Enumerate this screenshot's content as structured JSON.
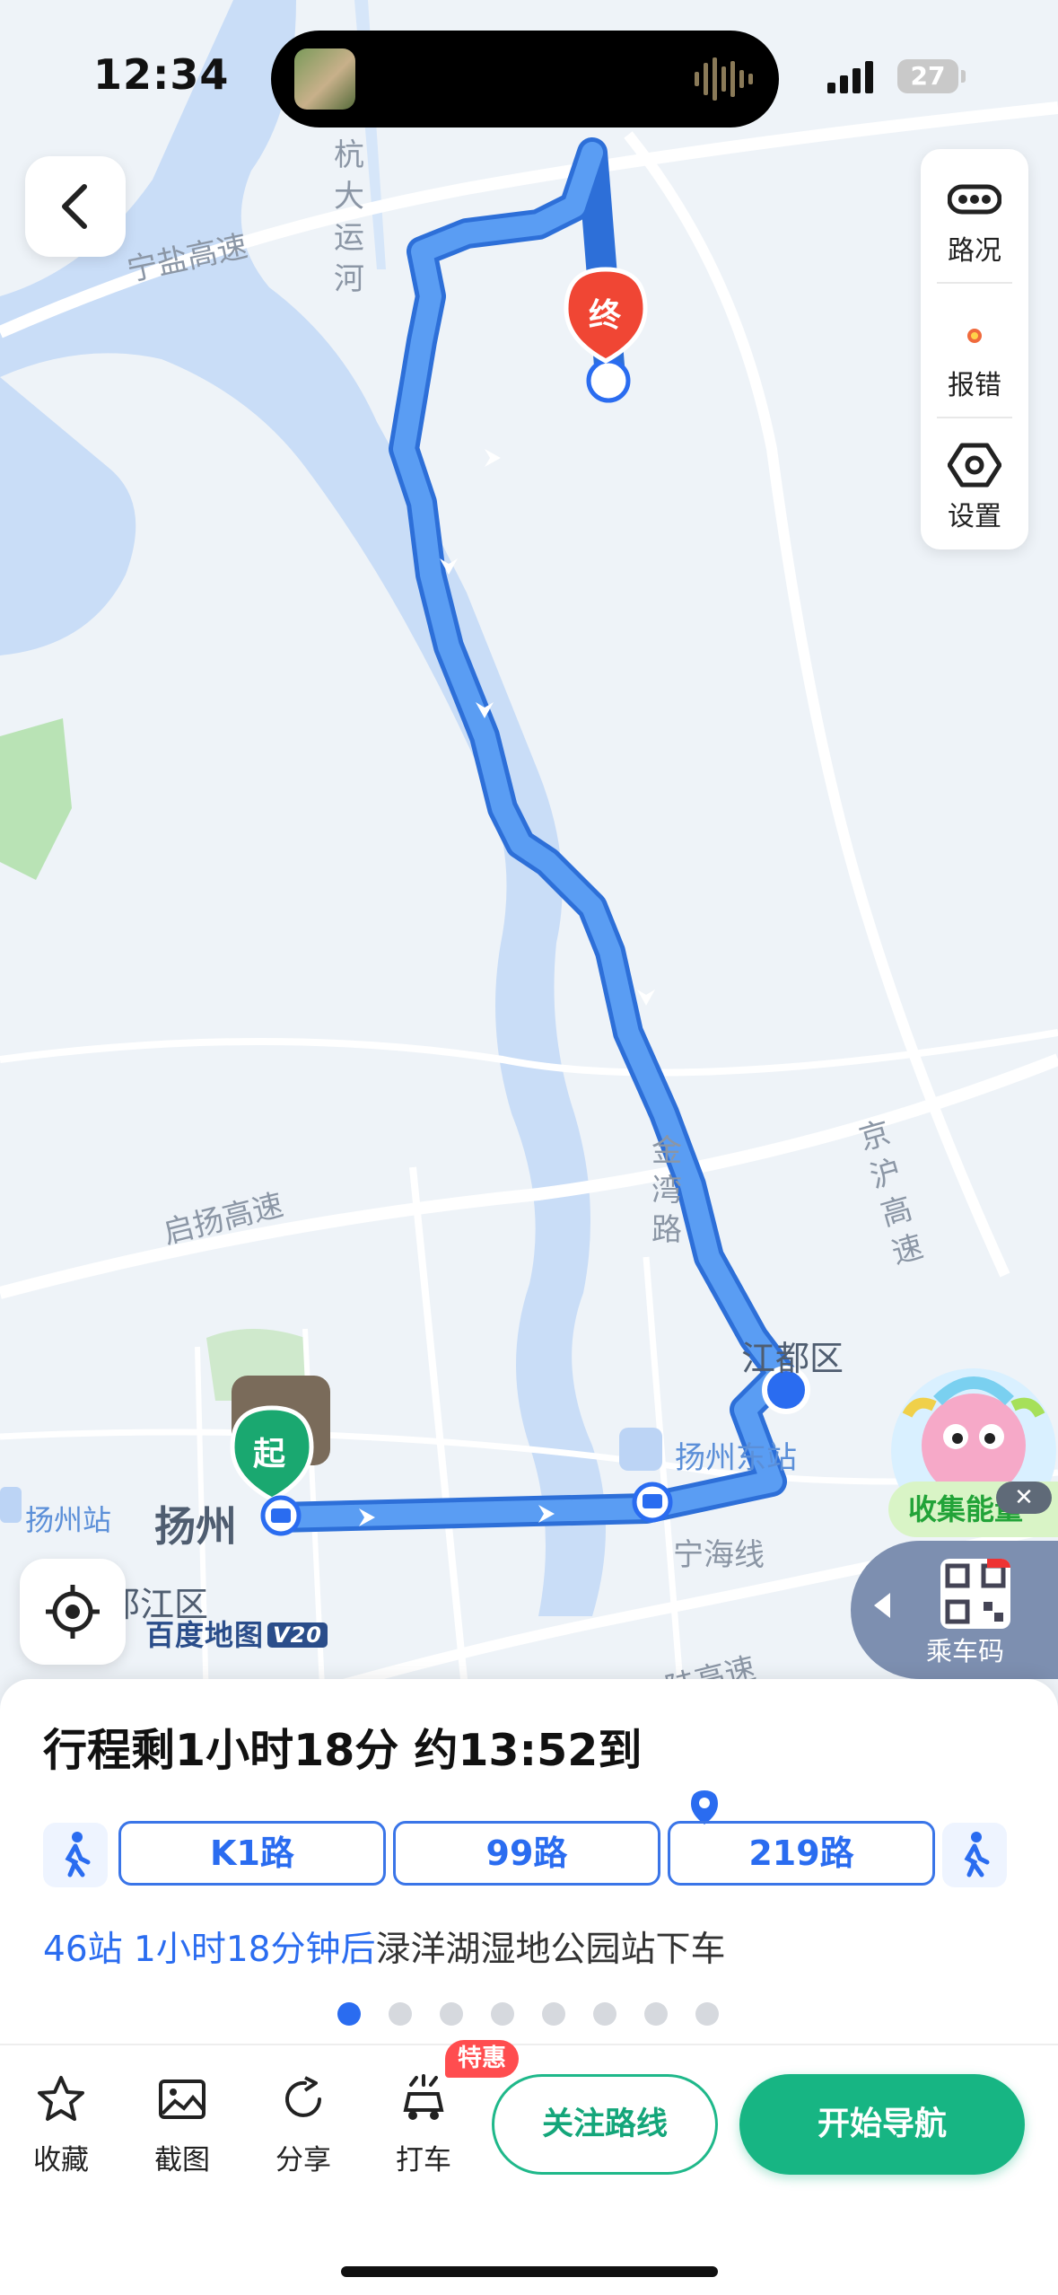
{
  "status_bar": {
    "time": "12:34",
    "battery": "27"
  },
  "toolbar": {
    "traffic_label": "路况",
    "report_label": "报错",
    "settings_label": "设置"
  },
  "map": {
    "labels": {
      "ningyan_highway": "宁盐高速",
      "grand_canal": "杭大运河",
      "qiyang_highway": "启扬高速",
      "jinwan_road": "金湾路",
      "jinghu_highway": "京沪高速",
      "jiangdu_district": "江都区",
      "yangzhou_east_station": "扬州东站",
      "yangzhou_station": "扬州站",
      "yangzhou": "扬州",
      "ninghai_line": "宁海线",
      "hanjiang_district": "邗江区",
      "highway_bottom": "陆高速"
    },
    "start_marker": "起",
    "end_marker": "终",
    "baidu_logo": "百度地图",
    "baidu_version": "V20",
    "collect_energy": "收集能量",
    "ride_code": "乘车码"
  },
  "trip": {
    "summary": "行程剩1小时18分 约13:52到",
    "routes": [
      "K1路",
      "99路",
      "219路"
    ],
    "detail_highlight": "46站 1小时18分钟后",
    "detail_rest": "渌洋湖湿地公园站下车",
    "page_count": 8,
    "active_page": 1
  },
  "actions": {
    "favorite": "收藏",
    "screenshot": "截图",
    "share": "分享",
    "taxi": "打车",
    "promo_badge": "特惠",
    "follow_route": "关注路线",
    "start_navigation": "开始导航"
  },
  "colors": {
    "route_blue": "#4a8ef0",
    "accent_blue": "#2a6cf0",
    "start_green": "#1aa870",
    "end_red": "#f04634",
    "nav_green": "#17b583"
  }
}
